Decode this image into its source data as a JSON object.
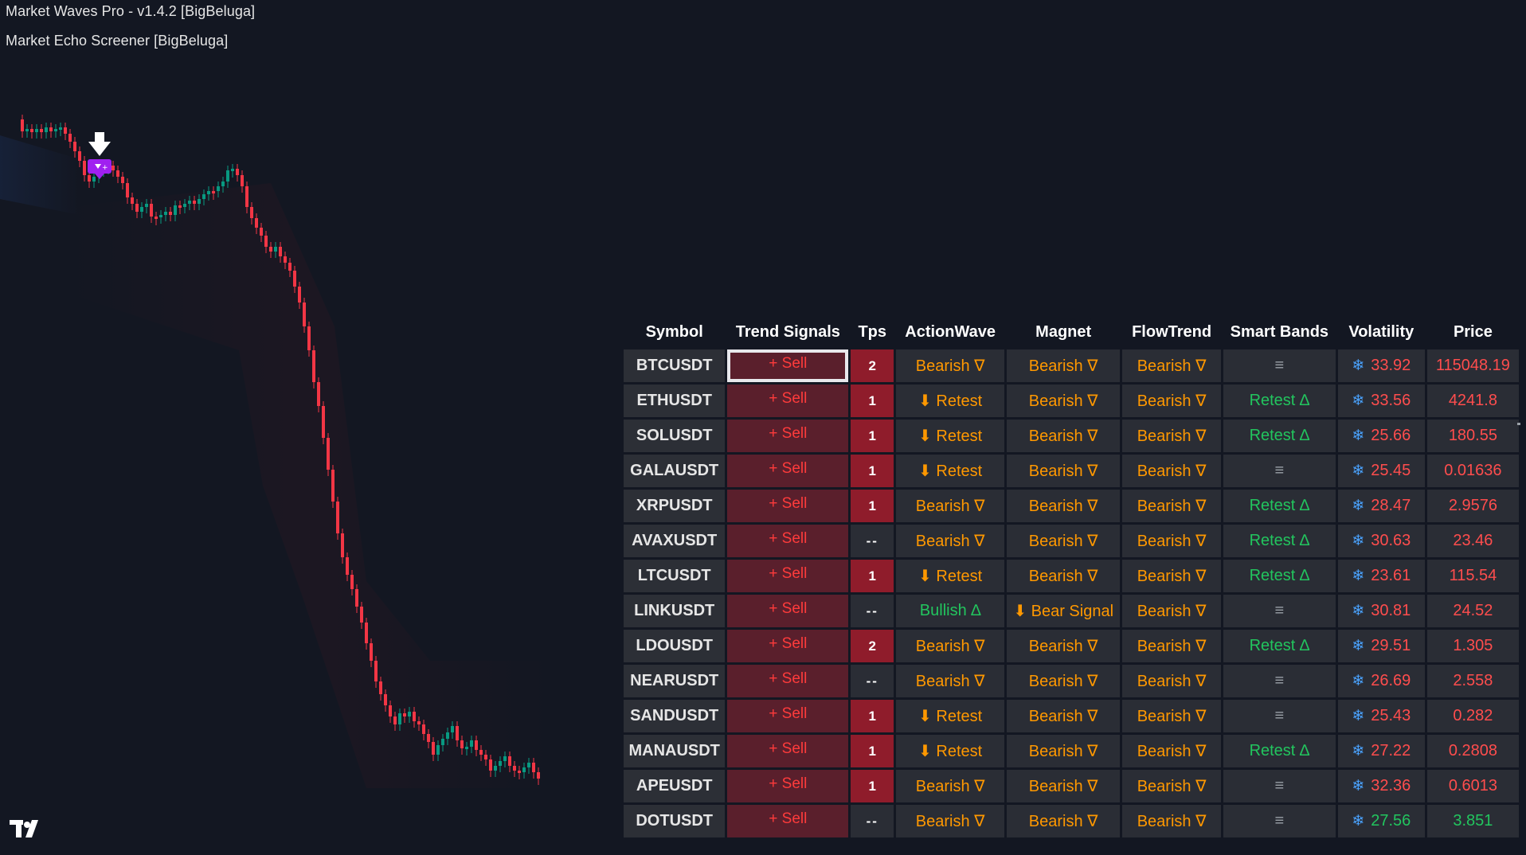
{
  "indicators": {
    "first": "Market Waves Pro - v1.4.2 [BigBeluga]",
    "second": "Market Echo Screener [BigBeluga]"
  },
  "marker": {
    "icon": "down-arrow-icon",
    "badge_icon": "bear-signal-icon",
    "badge_color": "#a020f0"
  },
  "logo": {
    "icon": "tradingview-logo"
  },
  "colors": {
    "background": "#131722",
    "bull_candle": "#089981",
    "bear_candle": "#f23645",
    "bearish": "#ff9800",
    "bullish": "#22c55e",
    "trend_sell_bg": "#5a1f2c",
    "tps_bg": "#8f1c2b"
  },
  "screener": {
    "headers": [
      "Symbol",
      "Trend Signals",
      "Tps",
      "ActionWave",
      "Magnet",
      "FlowTrend",
      "Smart Bands",
      "Volatility",
      "Price"
    ],
    "rows": [
      {
        "symbol": "BTCUSDT",
        "trend": "+ Sell",
        "tps": "2",
        "action": "Bearish ∇",
        "magnet": "Bearish ∇",
        "flow": "Bearish ∇",
        "bands": "≡",
        "vol": "33.92",
        "price": "115048.19"
      },
      {
        "symbol": "ETHUSDT",
        "trend": "+ Sell",
        "tps": "1",
        "action": "⬇ Retest",
        "magnet": "Bearish ∇",
        "flow": "Bearish ∇",
        "bands": "Retest ∆",
        "vol": "33.56",
        "price": "4241.8"
      },
      {
        "symbol": "SOLUSDT",
        "trend": "+ Sell",
        "tps": "1",
        "action": "⬇ Retest",
        "magnet": "Bearish ∇",
        "flow": "Bearish ∇",
        "bands": "Retest ∆",
        "vol": "25.66",
        "price": "180.55"
      },
      {
        "symbol": "GALAUSDT",
        "trend": "+ Sell",
        "tps": "1",
        "action": "⬇ Retest",
        "magnet": "Bearish ∇",
        "flow": "Bearish ∇",
        "bands": "≡",
        "vol": "25.45",
        "price": "0.01636"
      },
      {
        "symbol": "XRPUSDT",
        "trend": "+ Sell",
        "tps": "1",
        "action": "Bearish ∇",
        "magnet": "Bearish ∇",
        "flow": "Bearish ∇",
        "bands": "Retest ∆",
        "vol": "28.47",
        "price": "2.9576"
      },
      {
        "symbol": "AVAXUSDT",
        "trend": "+ Sell",
        "tps": "--",
        "action": "Bearish ∇",
        "magnet": "Bearish ∇",
        "flow": "Bearish ∇",
        "bands": "Retest ∆",
        "vol": "30.63",
        "price": "23.46"
      },
      {
        "symbol": "LTCUSDT",
        "trend": "+ Sell",
        "tps": "1",
        "action": "⬇ Retest",
        "magnet": "Bearish ∇",
        "flow": "Bearish ∇",
        "bands": "Retest ∆",
        "vol": "23.61",
        "price": "115.54"
      },
      {
        "symbol": "LINKUSDT",
        "trend": "+ Sell",
        "tps": "--",
        "action": "Bullish ∆",
        "magnet": "⬇ Bear Signal",
        "flow": "Bearish ∇",
        "bands": "≡",
        "vol": "30.81",
        "price": "24.52"
      },
      {
        "symbol": "LDOUSDT",
        "trend": "+ Sell",
        "tps": "2",
        "action": "Bearish ∇",
        "magnet": "Bearish ∇",
        "flow": "Bearish ∇",
        "bands": "Retest ∆",
        "vol": "29.51",
        "price": "1.305"
      },
      {
        "symbol": "NEARUSDT",
        "trend": "+ Sell",
        "tps": "--",
        "action": "Bearish ∇",
        "magnet": "Bearish ∇",
        "flow": "Bearish ∇",
        "bands": "≡",
        "vol": "26.69",
        "price": "2.558"
      },
      {
        "symbol": "SANDUSDT",
        "trend": "+ Sell",
        "tps": "1",
        "action": "⬇ Retest",
        "magnet": "Bearish ∇",
        "flow": "Bearish ∇",
        "bands": "≡",
        "vol": "25.43",
        "price": "0.282"
      },
      {
        "symbol": "MANAUSDT",
        "trend": "+ Sell",
        "tps": "1",
        "action": "⬇ Retest",
        "magnet": "Bearish ∇",
        "flow": "Bearish ∇",
        "bands": "Retest ∆",
        "vol": "27.22",
        "price": "0.2808"
      },
      {
        "symbol": "APEUSDT",
        "trend": "+ Sell",
        "tps": "1",
        "action": "Bearish ∇",
        "magnet": "Bearish ∇",
        "flow": "Bearish ∇",
        "bands": "≡",
        "vol": "32.36",
        "price": "0.6013"
      },
      {
        "symbol": "DOTUSDT",
        "trend": "+ Sell",
        "tps": "--",
        "action": "Bearish ∇",
        "magnet": "Bearish ∇",
        "flow": "Bearish ∇",
        "bands": "≡",
        "vol": "27.56",
        "price": "3.851",
        "bullish_vol": true
      }
    ]
  }
}
